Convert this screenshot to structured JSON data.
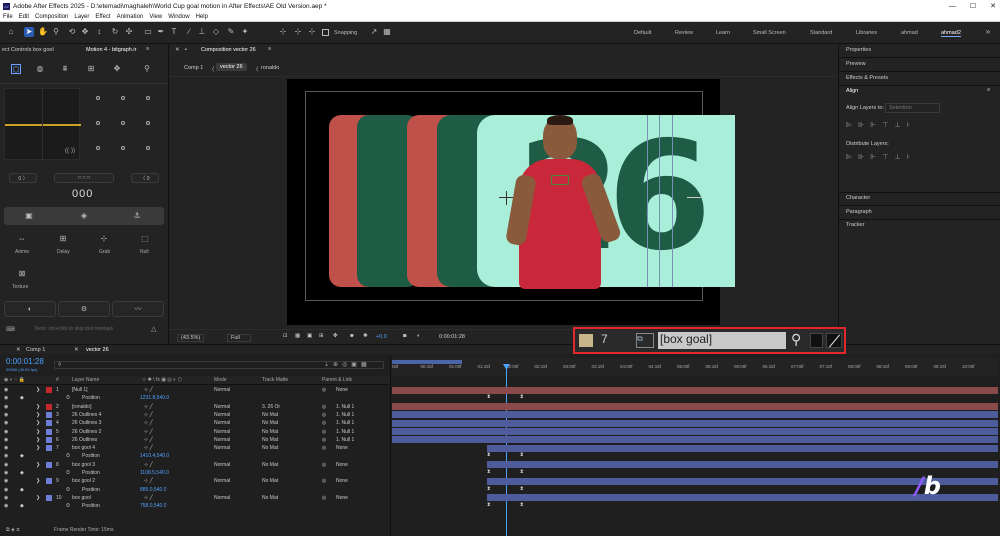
{
  "title": "Adobe After Effects 2025 - D:\\etemadi\\maghaleh\\World Cup goal motion in After Effects\\AE Old Version.aep *",
  "menu": [
    "File",
    "Edit",
    "Composition",
    "Layer",
    "Effect",
    "Animation",
    "View",
    "Window",
    "Help"
  ],
  "toolbar": {
    "snapping_label": "Snapping"
  },
  "workspaces": [
    "Default",
    "Review",
    "Learn",
    "Small Screen",
    "Standard",
    "Libraries",
    "ahmad",
    "ahmad2"
  ],
  "left_panel": {
    "tab1": "ect Controls box gool",
    "tab2": "Motion 4 - bitgraph.ir",
    "counter": "000",
    "buttons": [
      "Anime",
      "Delay",
      "Grab",
      "Null",
      "Texture"
    ],
    "hint": "Tools: ctrl+click to skip tool overlays"
  },
  "comp_panel": {
    "tab": "Composition vector 26",
    "breadcrumbs": [
      "Comp 1",
      "vector 26",
      "ronaldo"
    ],
    "zoom": "(43.5%)",
    "resolution": "Full",
    "exposure": "+0.0",
    "timecode": "0:00:01:28"
  },
  "right_panel": {
    "items": [
      "Properties",
      "Preview",
      "Effects & Presets",
      "Align",
      "Character",
      "Paragraph",
      "Tracker"
    ],
    "align_to_label": "Align Layers to:",
    "align_to_value": "Selection",
    "distribute_label": "Distribute Layers:"
  },
  "callout": {
    "number": "7",
    "name": "[box goal]"
  },
  "timeline": {
    "tabs": [
      "Comp 1",
      "vector 26"
    ],
    "timecode": "0:00:01:28",
    "frame_info": "00058 (30.00 fps)",
    "headers": {
      "layer_name": "Layer Name",
      "mode": "Mode",
      "track_matte": "Track Matte",
      "parent": "Parent & Link"
    },
    "ruler": [
      "00f",
      "00:15f",
      "01:00f",
      "01:15f",
      "02:00f",
      "02:15f",
      "03:00f",
      "03:15f",
      "04:00f",
      "04:15f",
      "05:00f",
      "05:15f",
      "06:00f",
      "06:15f",
      "07:00f",
      "07:15f",
      "08:00f",
      "08:15f",
      "09:00f",
      "09:15f",
      "10:00f"
    ],
    "rows": [
      {
        "num": "1",
        "name": "[Null 1]",
        "mode": "Normal",
        "matte": "",
        "parent": "None",
        "color": "#c4272c",
        "kind": "layer"
      },
      {
        "num": "",
        "name": "Position",
        "value": "1231.8,540.0",
        "kind": "prop"
      },
      {
        "num": "2",
        "name": "[ronaldo]",
        "mode": "Normal",
        "matte": "3. 26 Or",
        "parent": "1. Null 1",
        "color": "#c4272c",
        "kind": "layer"
      },
      {
        "num": "3",
        "name": "26 Outlines 4",
        "mode": "Normal",
        "matte": "No Mat",
        "parent": "1. Null 1",
        "color": "#6e7ed6",
        "kind": "layer"
      },
      {
        "num": "4",
        "name": "26 Outlines 3",
        "mode": "Normal",
        "matte": "No Mat",
        "parent": "1. Null 1",
        "color": "#6e7ed6",
        "kind": "layer"
      },
      {
        "num": "5",
        "name": "26 Outlines 2",
        "mode": "Normal",
        "matte": "No Mat",
        "parent": "1. Null 1",
        "color": "#6e7ed6",
        "kind": "layer"
      },
      {
        "num": "6",
        "name": "26 Outlines",
        "mode": "Normal",
        "matte": "No Mat",
        "parent": "1. Null 1",
        "color": "#6e7ed6",
        "kind": "layer"
      },
      {
        "num": "7",
        "name": "box gool 4",
        "mode": "Normal",
        "matte": "No Mat",
        "parent": "None",
        "color": "#6e7ed6",
        "kind": "layer"
      },
      {
        "num": "",
        "name": "Position",
        "value": "1410.4,540.0",
        "kind": "prop"
      },
      {
        "num": "8",
        "name": "box gool 3",
        "mode": "Normal",
        "matte": "No Mat",
        "parent": "None",
        "color": "#6e7ed6",
        "kind": "layer"
      },
      {
        "num": "",
        "name": "Position",
        "value": "1108.5,540.0",
        "kind": "prop"
      },
      {
        "num": "9",
        "name": "box gool 2",
        "mode": "Normal",
        "matte": "No Mat",
        "parent": "None",
        "color": "#6e7ed6",
        "kind": "layer"
      },
      {
        "num": "",
        "name": "Position",
        "value": "889.0,540.0",
        "kind": "prop"
      },
      {
        "num": "10",
        "name": "box gool",
        "mode": "Normal",
        "matte": "No Mat",
        "parent": "None",
        "color": "#6e7ed6",
        "kind": "layer"
      },
      {
        "num": "",
        "name": "Position",
        "value": "758.0,540.0",
        "kind": "prop"
      }
    ],
    "footer": "Frame Render Time: 15ms"
  },
  "colors": {
    "accent": "#2d5db3",
    "red_box": "#c0504a",
    "dark_green": "#1e5c46",
    "mint": "#a8eed9",
    "callout_border": "#e0282e"
  }
}
